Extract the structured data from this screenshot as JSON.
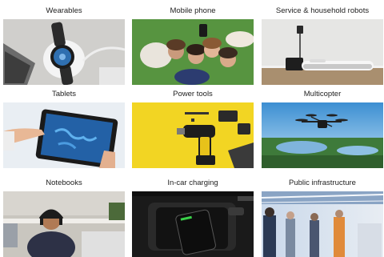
{
  "tiles": [
    {
      "label": "Wearables",
      "image": "smartwatch-on-wireless-charger-photo"
    },
    {
      "label": "Mobile phone",
      "image": "friends-taking-selfie-on-grass-photo"
    },
    {
      "label": "Service & household robots",
      "image": "robot-vacuum-docking-station-photo"
    },
    {
      "label": "Tablets",
      "image": "hand-using-tablet-photo"
    },
    {
      "label": "Power tools",
      "image": "cordless-drill-and-batteries-photo"
    },
    {
      "label": "Multicopter",
      "image": "drone-over-lake-landscape-photo"
    },
    {
      "label": "Notebooks",
      "image": "woman-with-headset-at-laptop-photo"
    },
    {
      "label": "In-car charging",
      "image": "phone-in-car-charging-tray-photo"
    },
    {
      "label": "Public infrastructure",
      "image": "people-in-station-hall-photo"
    }
  ]
}
